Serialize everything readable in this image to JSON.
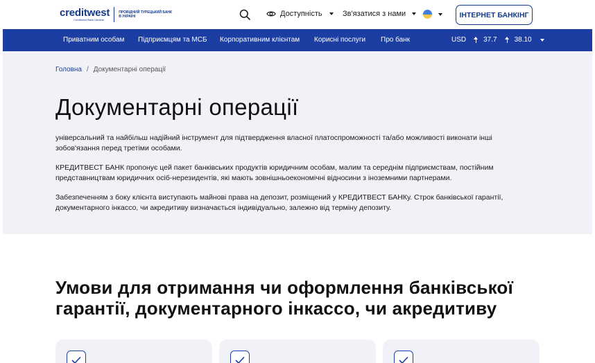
{
  "header": {
    "logo_word": "creditwest",
    "logo_sub": "Creditwest Bank Ukraine",
    "logo_tagline": "ПРОВІДНИЙ ТУРЕЦЬКИЙ БАНК В УКРАЇНІ",
    "accessibility_label": "Доступність",
    "contact_label": "Зв'язатися з нами",
    "internet_banking_label": "ІНТЕРНЕТ БАНКІНГ"
  },
  "nav": {
    "items": [
      {
        "label": "Приватним особам"
      },
      {
        "label": "Підприємцям та МСБ"
      },
      {
        "label": "Корпоративним клієнтам"
      },
      {
        "label": "Корисні послуги"
      },
      {
        "label": "Про банк"
      }
    ],
    "currency": "USD",
    "buy": "37.7",
    "sell": "38.10"
  },
  "breadcrumb": {
    "home": "Головна",
    "separator": "/",
    "current": "Документарні операції"
  },
  "hero": {
    "title": "Документарні операції",
    "paragraphs": [
      "універсальний та найбільш надійний інструмент для підтвердження власної платоспроможності та/або можливості виконати інші зобов'язання перед третіми особами.",
      "КРЕДИТВЕСТ БАНК пропонує цей пакет банківських продуктів юридичним особам, малим та середнім підприємствам, постійним представництвам юридичних осіб-нерезидентів, які мають зовнішньоекономічні відносини з іноземними партнерами.",
      "Забезпеченням з боку клієнта виступають майнові права на депозит, розміщений у КРЕДИТВЕСТ БАНКу. Строк банківської гарантії, документарного інкассо, чи акредитиву визначається індивідуально, залежно від терміну депозиту."
    ]
  },
  "conditions": {
    "title": "Умови для отримання чи оформлення банківської гарантії, документарного інкассо, чи акредитиву"
  },
  "colors": {
    "brand_blue": "#1c3ea2",
    "hero_bg": "#f1f2f7",
    "flag_blue": "#3f7fd6",
    "flag_yellow": "#f4c84a"
  },
  "icons": [
    "search-icon",
    "eye-icon",
    "chevron-down-icon",
    "flag-ua-icon",
    "arrow-up-icon",
    "check-icon"
  ]
}
